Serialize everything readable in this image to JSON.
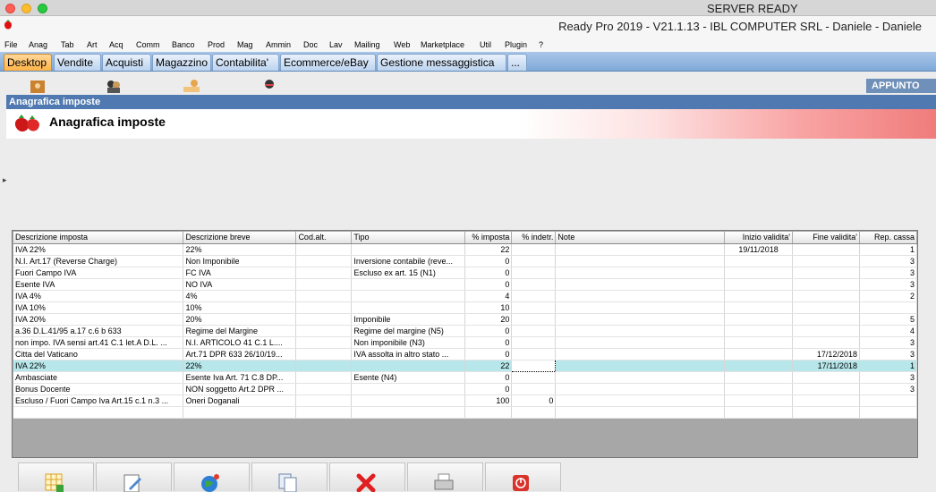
{
  "os": {
    "status": "SERVER READY"
  },
  "app": {
    "title": "Ready Pro 2019 - V21.1.13 - IBL COMPUTER SRL - Daniele - Daniele"
  },
  "menu": [
    "File",
    "Anag",
    "Tab",
    "Art",
    "Acq",
    "Comm",
    "Banco",
    "Prod",
    "Mag",
    "Ammin",
    "Doc",
    "Lav",
    "Mailing",
    "Web",
    "Marketplace",
    "Util",
    "Plugin",
    "?"
  ],
  "tabs": [
    "Desktop",
    "Vendite",
    "Acquisti",
    "Magazzino",
    "Contabilita'",
    "Ecommerce/eBay",
    "Gestione messaggistica",
    "..."
  ],
  "desktop": {
    "appunto": "APPUNTO"
  },
  "window": {
    "title": "Anagrafica imposte",
    "heading": "Anagrafica imposte"
  },
  "table": {
    "columns": [
      "Descrizione imposta",
      "Descrizione breve",
      "Cod.alt.",
      "Tipo",
      "% imposta",
      "% indetr.",
      "Note",
      "Inizio validita'",
      "Fine validita'",
      "Rep. cassa"
    ],
    "rows": [
      [
        "IVA 22%",
        "22%",
        "",
        "",
        "22",
        "",
        "",
        "19/11/2018",
        "",
        "1"
      ],
      [
        "N.I. Art.17 (Reverse Charge)",
        "Non Imponibile",
        "",
        "Inversione contabile (reve...",
        "0",
        "",
        "",
        "",
        "",
        "3"
      ],
      [
        "Fuori Campo IVA",
        "FC IVA",
        "",
        "Escluso ex art. 15 (N1)",
        "0",
        "",
        "",
        "",
        "",
        "3"
      ],
      [
        "Esente IVA",
        "NO IVA",
        "",
        "",
        "0",
        "",
        "",
        "",
        "",
        "3"
      ],
      [
        "IVA 4%",
        "4%",
        "",
        "",
        "4",
        "",
        "",
        "",
        "",
        "2"
      ],
      [
        "IVA 10%",
        "10%",
        "",
        "",
        "10",
        "",
        "",
        "",
        "",
        ""
      ],
      [
        "IVA 20%",
        "20%",
        "",
        "Imponibile",
        "20",
        "",
        "",
        "",
        "",
        "5"
      ],
      [
        "a.36 D.L.41/95 a.17 c.6 b 633",
        "Regime del Margine",
        "",
        "Regime del margine (N5)",
        "0",
        "",
        "",
        "",
        "",
        "4"
      ],
      [
        "non impo. IVA sensi art.41 C.1 let.A D.L. ...",
        "N.I. ARTICOLO 41 C.1 L....",
        "",
        "Non imponibile (N3)",
        "0",
        "",
        "",
        "",
        "",
        "3"
      ],
      [
        "Citta del Vaticano",
        "Art.71 DPR 633 26/10/19...",
        "",
        "IVA assolta in altro stato ...",
        "0",
        "",
        "",
        "",
        "17/12/2018",
        "3"
      ],
      [
        "IVA 22%",
        "22%",
        "",
        "",
        "22",
        "",
        "",
        "",
        "17/11/2018",
        "1"
      ],
      [
        "Ambasciate",
        "Esente Iva Art. 71 C.8 DP...",
        "",
        "Esente (N4)",
        "0",
        "",
        "",
        "",
        "",
        "3"
      ],
      [
        "Bonus Docente",
        "NON soggetto Art.2 DPR ...",
        "",
        "",
        "0",
        "",
        "",
        "",
        "",
        "3"
      ],
      [
        "Escluso / Fuori Campo Iva Art.15 c.1 n.3 ...",
        "Oneri Doganali",
        "",
        "",
        "100",
        "0",
        "",
        "",
        "",
        ""
      ],
      [
        "",
        "",
        "",
        "",
        "",
        "",
        "",
        "",
        "",
        ""
      ]
    ],
    "selected_row": 10
  },
  "toolbar": {
    "buttons": [
      {
        "name": "new-record-button",
        "icon": "grid-add-icon"
      },
      {
        "name": "edit-record-button",
        "icon": "edit-icon"
      },
      {
        "name": "web-button",
        "icon": "globe-icon"
      },
      {
        "name": "copy-record-button",
        "icon": "copy-icon"
      },
      {
        "name": "delete-record-button",
        "icon": "delete-icon"
      },
      {
        "name": "print-button",
        "icon": "printer-icon"
      },
      {
        "name": "close-button",
        "icon": "power-icon"
      }
    ]
  }
}
